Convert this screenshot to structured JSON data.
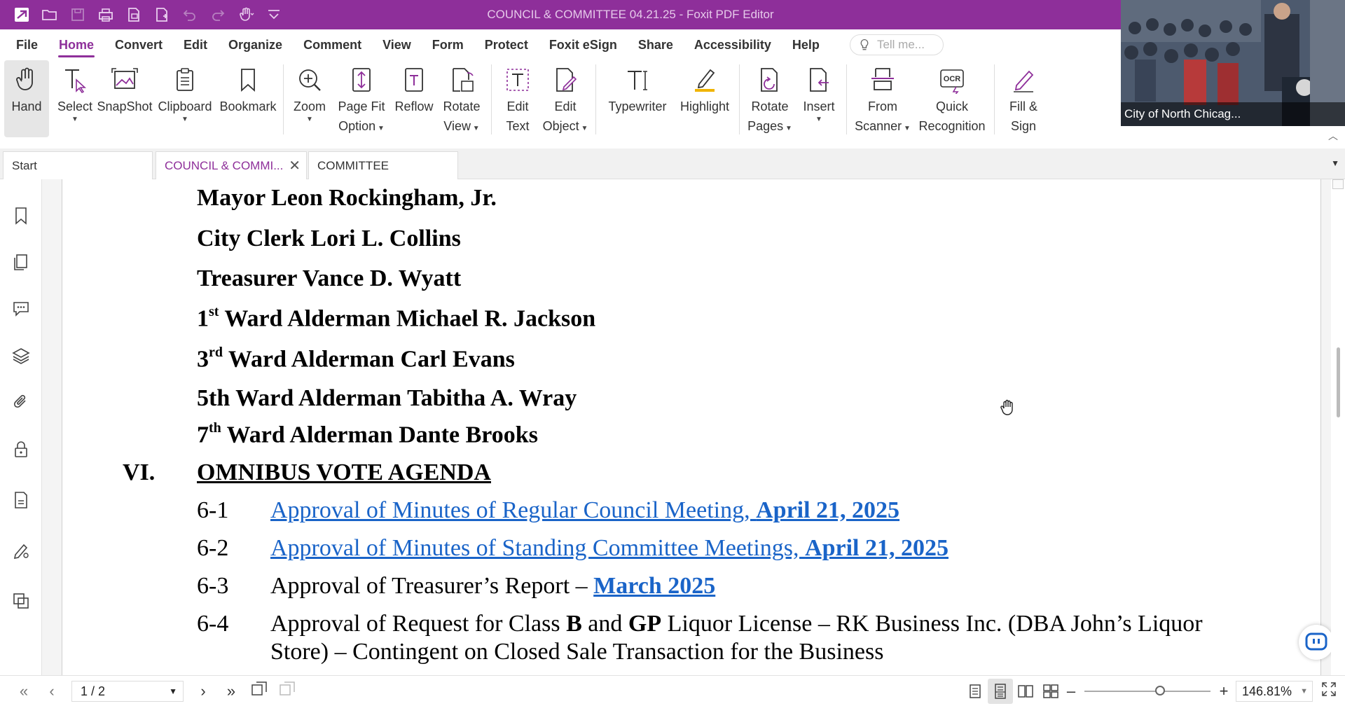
{
  "app": {
    "title": "COUNCIL & COMMITTEE 04.21.25 - Foxit PDF Editor",
    "accent_color": "#8e2f9a",
    "quick_access_icons": [
      "app-logo-icon",
      "open-icon",
      "save-icon",
      "print-icon",
      "scan-icon",
      "new-icon",
      "undo-icon",
      "redo-icon",
      "hand-mode-icon",
      "customize-icon"
    ]
  },
  "menu": {
    "items": [
      "File",
      "Home",
      "Convert",
      "Edit",
      "Organize",
      "Comment",
      "View",
      "Form",
      "Protect",
      "Foxit eSign",
      "Share",
      "Accessibility",
      "Help"
    ],
    "active": "Home",
    "tellme_placeholder": "Tell me..."
  },
  "ribbon": {
    "hand": "Hand",
    "select": "Select",
    "snapshot": "SnapShot",
    "clipboard": "Clipboard",
    "bookmark": "Bookmark",
    "zoom": "Zoom",
    "page_fit_1": "Page Fit",
    "page_fit_2": "Option",
    "reflow": "Reflow",
    "rotate_view_1": "Rotate",
    "rotate_view_2": "View",
    "edit_text_1": "Edit",
    "edit_text_2": "Text",
    "edit_object_1": "Edit",
    "edit_object_2": "Object",
    "typewriter": "Typewriter",
    "highlight": "Highlight",
    "rotate_pages_1": "Rotate",
    "rotate_pages_2": "Pages",
    "insert": "Insert",
    "from_scanner_1": "From",
    "from_scanner_2": "Scanner",
    "quick_recognition_1": "Quick",
    "quick_recognition_2": "Recognition",
    "fill_sign_1": "Fill &",
    "fill_sign_2": "Sign",
    "ocr_label": "OCR"
  },
  "video": {
    "caption": "City of North Chicag..."
  },
  "tabs": [
    {
      "label": "Start"
    },
    {
      "label": "COUNCIL & COMMI..."
    },
    {
      "label": "COMMITTEE"
    }
  ],
  "document": {
    "roll": [
      {
        "text": "Mayor Leon Rockingham, Jr."
      },
      {
        "text": "City Clerk Lori L. Collins"
      },
      {
        "text": "Treasurer Vance D. Wyatt"
      },
      {
        "num": "1",
        "sup": "st",
        "rest": " Ward Alderman Michael R. Jackson"
      },
      {
        "num": "3",
        "sup": "rd",
        "rest": " Ward Alderman Carl Evans"
      },
      {
        "text": "5th Ward Alderman Tabitha A. Wray"
      },
      {
        "num": "7",
        "sup": "th",
        "rest": " Ward Alderman Dante Brooks"
      }
    ],
    "section_no": "VI.",
    "section_title": "OMNIBUS VOTE AGENDA",
    "items": [
      {
        "no": "6-1",
        "link_text": "Approval of Minutes of Regular Council Meeting, ",
        "link_bold": "April 21, 2025"
      },
      {
        "no": "6-2",
        "link_text": "Approval of Minutes of Standing Committee Meetings, ",
        "link_bold": "April 21, 2025"
      },
      {
        "no": "6-3",
        "text": "Approval of Treasurer’s Report – ",
        "link_bold": "March 2025"
      },
      {
        "no": "6-4",
        "text_a": "Approval of Request for Class ",
        "bold_a": "B",
        "text_b": " and ",
        "bold_b": "GP",
        "text_c": " Liquor License – RK Business Inc. (DBA John’s Liquor",
        "text_line2": "Store) – Contingent on Closed Sale Transaction for the Business"
      }
    ]
  },
  "statusbar": {
    "page_indicator": "1 / 2",
    "zoom": "146.81%",
    "zoom_fraction": 0.6
  },
  "left_panel_icons": [
    "bookmark-panel-icon",
    "pages-panel-icon",
    "comments-panel-icon",
    "layers-panel-icon",
    "attachments-panel-icon",
    "security-panel-icon",
    "document-panel-icon",
    "signature-panel-icon",
    "destinations-panel-icon"
  ]
}
